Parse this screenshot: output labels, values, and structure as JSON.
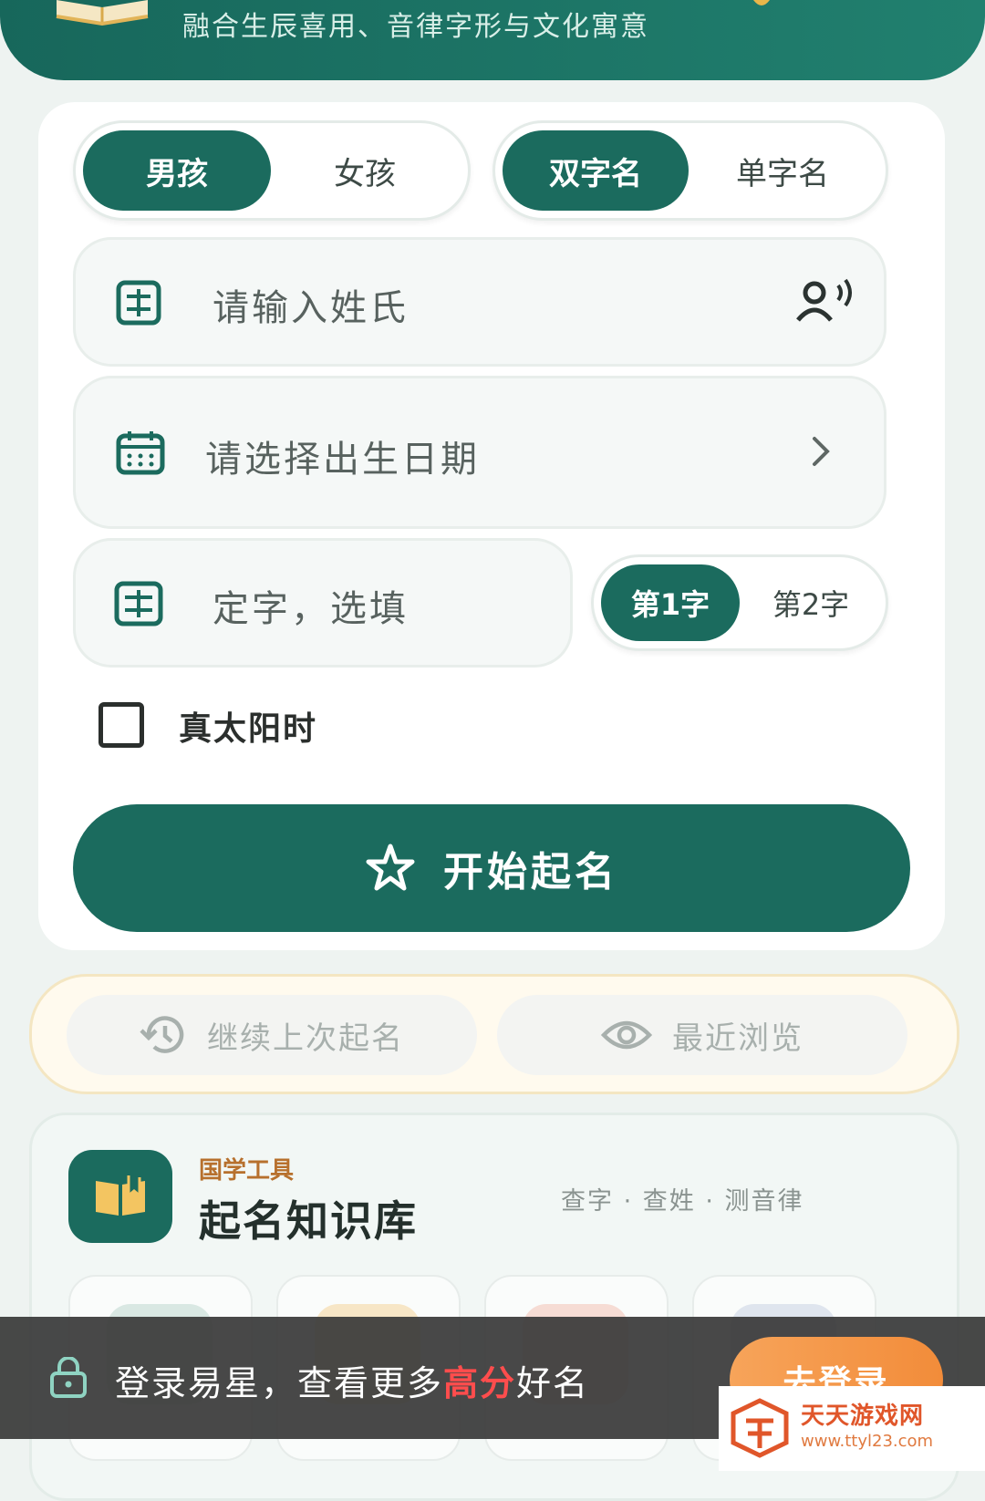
{
  "header": {
    "subtitle": "融合生辰喜用、音律字形与文化寓意"
  },
  "gender_toggle": {
    "boy": "男孩",
    "girl": "女孩",
    "selected": "boy"
  },
  "length_toggle": {
    "double": "双字名",
    "single": "单字名",
    "selected": "double"
  },
  "surname_field": {
    "placeholder": "请输入姓氏"
  },
  "birth_field": {
    "placeholder": "请选择出生日期"
  },
  "fixed_char_field": {
    "placeholder": "定字，选填"
  },
  "char_position": {
    "first": "第1字",
    "second": "第2字",
    "selected": "first"
  },
  "true_solar": {
    "label": "真太阳时",
    "checked": false
  },
  "start_button": {
    "label": "开始起名"
  },
  "recent": {
    "continue": "继续上次起名",
    "browse": "最近浏览"
  },
  "knowledge": {
    "tag": "国学工具",
    "title": "起名知识库",
    "links": "查字 · 查姓 · 测音律"
  },
  "login_banner": {
    "msg_prefix": "登录易星，查看更多",
    "msg_highlight": "高分",
    "msg_suffix": "好名",
    "button": "去登录"
  },
  "watermark": {
    "name": "天天游戏网",
    "url": "www.ttyl23.com"
  },
  "colors": {
    "primary": "#1b6b5e",
    "accent_orange": "#f28c3a",
    "highlight_red": "#ff4d4d"
  }
}
